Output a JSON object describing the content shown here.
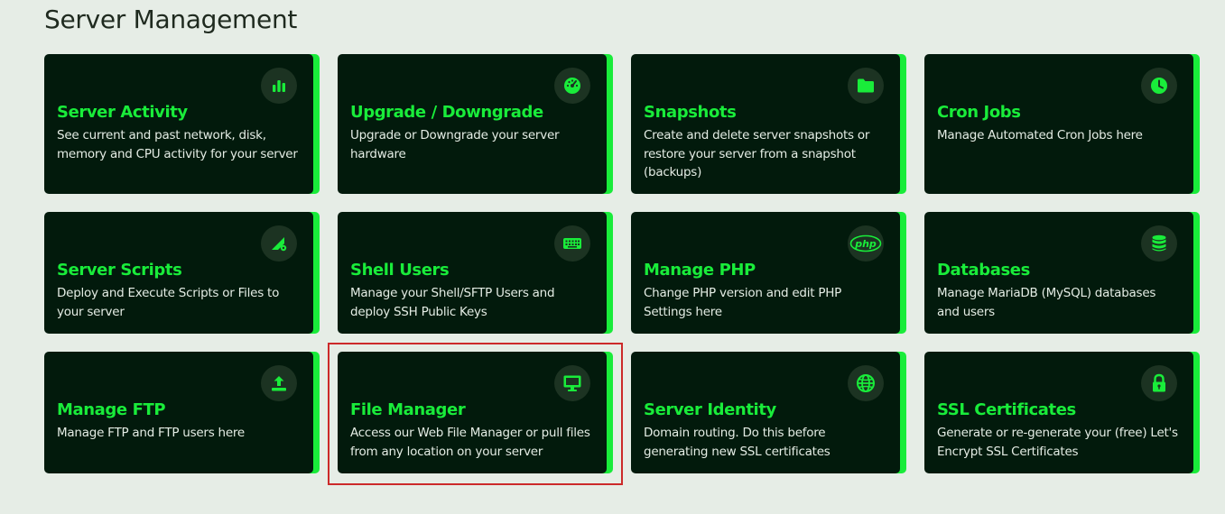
{
  "page": {
    "title": "Server Management"
  },
  "colors": {
    "background": "#e6ede6",
    "card_background": "#021a0c",
    "accent": "#19ec3a",
    "icon_circle": "#1c3322",
    "highlight_border": "#cc2a2a"
  },
  "cards": [
    {
      "title": "Server Activity",
      "description": "See current and past network, disk, memory and CPU activity for your server",
      "icon": "bar-chart-icon"
    },
    {
      "title": "Upgrade / Downgrade",
      "description": "Upgrade or Downgrade your server hardware",
      "icon": "speedometer-icon"
    },
    {
      "title": "Snapshots",
      "description": "Create and delete server snapshots or restore your server from a snapshot (backups)",
      "icon": "folder-icon"
    },
    {
      "title": "Cron Jobs",
      "description": "Manage Automated Cron Jobs here",
      "icon": "clock-icon"
    },
    {
      "title": "Server Scripts",
      "description": "Deploy and Execute Scripts or Files to your server",
      "icon": "script-gear-icon"
    },
    {
      "title": "Shell Users",
      "description": "Manage your Shell/SFTP Users and deploy SSH Public Keys",
      "icon": "keyboard-icon"
    },
    {
      "title": "Manage PHP",
      "description": "Change PHP version and edit PHP Settings here",
      "icon": "php-icon",
      "icon_text": "php"
    },
    {
      "title": "Databases",
      "description": "Manage MariaDB (MySQL) databases and users",
      "icon": "database-icon"
    },
    {
      "title": "Manage FTP",
      "description": "Manage FTP and FTP users here",
      "icon": "upload-icon"
    },
    {
      "title": "File Manager",
      "description": "Access our Web File Manager or pull files from any location on your server",
      "icon": "monitor-icon",
      "highlighted": true
    },
    {
      "title": "Server Identity",
      "description": "Domain routing. Do this before generating new SSL certificates",
      "icon": "globe-icon"
    },
    {
      "title": "SSL Certificates",
      "description": "Generate or re-generate your (free) Let's Encrypt SSL Certificates",
      "icon": "lock-icon"
    }
  ]
}
